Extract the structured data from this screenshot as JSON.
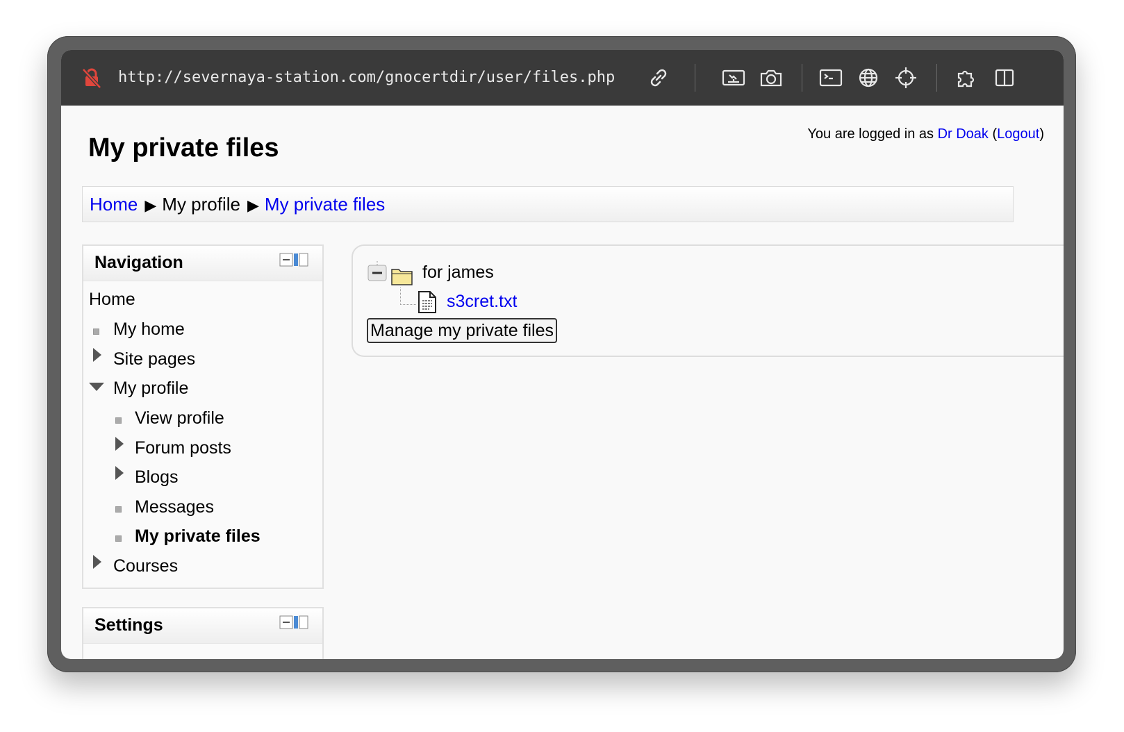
{
  "browser": {
    "url": "http://severnaya-station.com/gnocertdir/user/files.php",
    "toolbar_icons": [
      "link-icon",
      "responsive-icon",
      "camera-icon",
      "terminal-icon",
      "globe-icon",
      "crosshair-icon",
      "extension-icon",
      "sidebar-icon"
    ]
  },
  "header": {
    "page_title": "My private files",
    "login_prefix": "You are logged in as ",
    "user_name": "Dr Doak",
    "logout_open": " (",
    "logout_label": "Logout",
    "logout_close": ")"
  },
  "breadcrumb": {
    "items": [
      {
        "label": "Home",
        "link": true
      },
      {
        "label": "My profile",
        "link": false
      },
      {
        "label": "My private files",
        "link": true
      }
    ]
  },
  "navigation": {
    "title": "Navigation",
    "items": [
      {
        "label": "Home",
        "link": true,
        "marker": "none",
        "level": 0
      },
      {
        "label": "My home",
        "link": true,
        "marker": "bullet",
        "level": 1
      },
      {
        "label": "Site pages",
        "link": false,
        "marker": "collapsed",
        "level": 1
      },
      {
        "label": "My profile",
        "link": false,
        "marker": "expanded",
        "level": 1
      },
      {
        "label": "View profile",
        "link": true,
        "marker": "bullet",
        "level": 2
      },
      {
        "label": "Forum posts",
        "link": false,
        "marker": "collapsed",
        "level": 2
      },
      {
        "label": "Blogs",
        "link": false,
        "marker": "collapsed",
        "level": 2
      },
      {
        "label": "Messages",
        "link": true,
        "marker": "bullet",
        "level": 2
      },
      {
        "label": "My private files",
        "link": true,
        "marker": "bullet",
        "level": 2,
        "bold": true
      },
      {
        "label": "Courses",
        "link": false,
        "marker": "collapsed",
        "level": 1
      }
    ]
  },
  "settings": {
    "title": "Settings"
  },
  "files": {
    "folder_name": "for james",
    "file_name": "s3cret.txt",
    "manage_button": "Manage my private files"
  },
  "colors": {
    "link": "#0000ee",
    "toolbar_bg": "#3a3a3a",
    "lock_icon": "#e0463c"
  }
}
